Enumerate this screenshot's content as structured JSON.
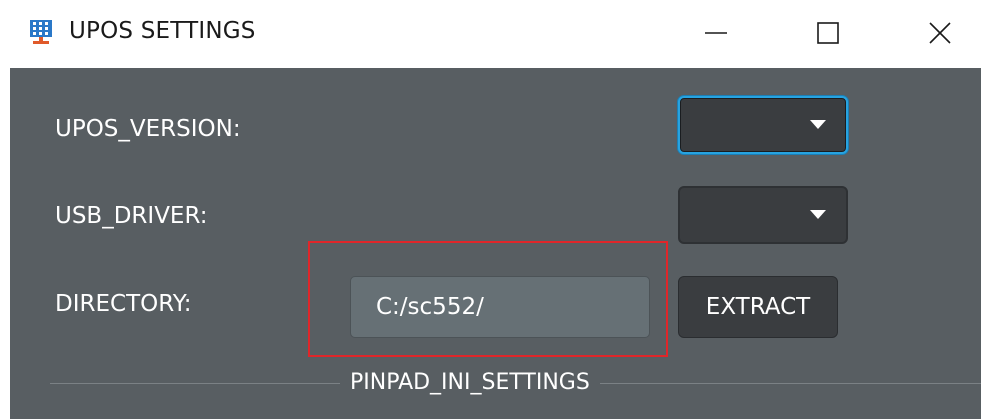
{
  "window": {
    "title": "UPOS SETTINGS",
    "app_icon": "grid-app-icon",
    "controls": [
      "minimize-icon",
      "maximize-icon",
      "close-icon"
    ]
  },
  "form": {
    "upos_version": {
      "label": "UPOS_VERSION:",
      "value": ""
    },
    "usb_driver": {
      "label": "USB_DRIVER:",
      "value": ""
    },
    "directory": {
      "label": "DIRECTORY:",
      "value": "C:/sc552/"
    },
    "extract_label": "EXTRACT"
  },
  "section": {
    "pinpad_label": "PINPAD_INI_SETTINGS"
  },
  "colors": {
    "content_bg": "#585e62",
    "combo_bg": "#3a3d40",
    "focus_border": "#27a3e0",
    "highlight": "#e0262a"
  }
}
